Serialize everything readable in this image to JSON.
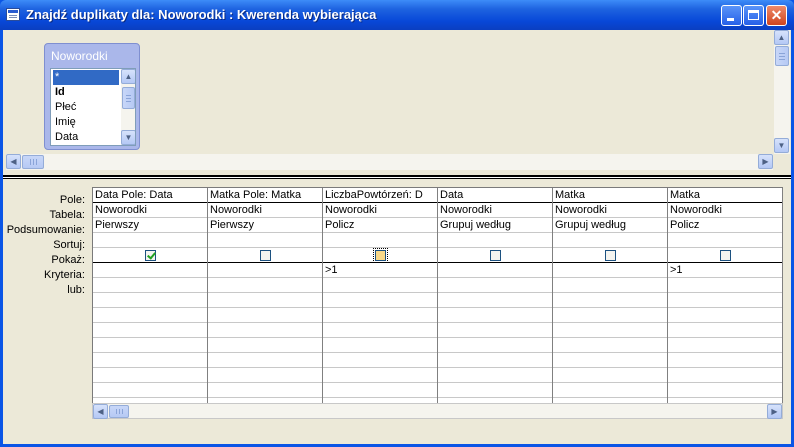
{
  "window": {
    "title": "Znajdź duplikaty dla: Noworodki : Kwerenda wybierająca",
    "minimize": "Minimize",
    "maximize": "Maximize",
    "close": "✕"
  },
  "table": {
    "name": "Noworodki",
    "fields": [
      "*",
      "Id",
      "Płeć",
      "Imię",
      "Data"
    ]
  },
  "row_labels": [
    "Pole:",
    "Tabela:",
    "Podsumowanie:",
    "Sortuj:",
    "Pokaż:",
    "Kryteria:",
    "lub:"
  ],
  "columns": [
    {
      "pole": "Data Pole: Data",
      "tabela": "Noworodki",
      "podsumowanie": "Pierwszy",
      "sortuj": "",
      "pokaz": true,
      "kryteria": "",
      "lub": ""
    },
    {
      "pole": "Matka Pole: Matka",
      "tabela": "Noworodki",
      "podsumowanie": "Pierwszy",
      "sortuj": "",
      "pokaz": false,
      "kryteria": "",
      "lub": ""
    },
    {
      "pole": "LiczbaPowtórzeń: D",
      "tabela": "Noworodki",
      "podsumowanie": "Policz",
      "sortuj": "",
      "pokaz": false,
      "kryteria": ">1",
      "lub": ""
    },
    {
      "pole": "Data",
      "tabela": "Noworodki",
      "podsumowanie": "Grupuj według",
      "sortuj": "",
      "pokaz": false,
      "kryteria": "",
      "lub": ""
    },
    {
      "pole": "Matka",
      "tabela": "Noworodki",
      "podsumowanie": "Grupuj według",
      "sortuj": "",
      "pokaz": false,
      "kryteria": "",
      "lub": ""
    },
    {
      "pole": "Matka",
      "tabela": "Noworodki",
      "podsumowanie": "Policz",
      "sortuj": "",
      "pokaz": false,
      "kryteria": ">1",
      "lub": ""
    }
  ]
}
